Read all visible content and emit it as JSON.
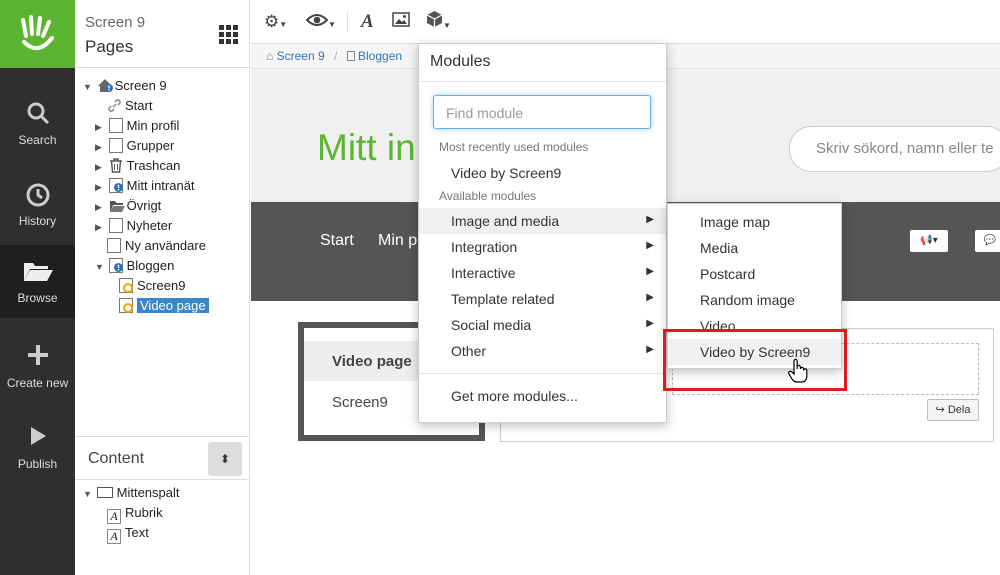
{
  "nav": {
    "items": [
      {
        "label": "Search",
        "icon": "search-icon"
      },
      {
        "label": "History",
        "icon": "history-icon"
      },
      {
        "label": "Browse",
        "icon": "folder-open-icon"
      },
      {
        "label": "Create new",
        "icon": "plus-icon"
      },
      {
        "label": "Publish",
        "icon": "play-icon"
      }
    ],
    "active": "Browse",
    "brand_color": "#5cb531"
  },
  "tree_panel": {
    "site": "Screen 9",
    "title": "Pages",
    "items": [
      {
        "label": "Screen 9"
      },
      {
        "label": "Start"
      },
      {
        "label": "Min profil"
      },
      {
        "label": "Grupper"
      },
      {
        "label": "Trashcan"
      },
      {
        "label": "Mitt intranät"
      },
      {
        "label": "Övrigt"
      },
      {
        "label": "Nyheter"
      },
      {
        "label": "Ny användare"
      },
      {
        "label": "Bloggen"
      },
      {
        "label": "Screen9"
      },
      {
        "label": "Video page"
      }
    ],
    "content_title": "Content",
    "content_items": [
      {
        "label": "Mittenspalt"
      },
      {
        "label": "Rubrik"
      },
      {
        "label": "Text"
      }
    ]
  },
  "breadcrumb": [
    "Screen 9",
    "Bloggen"
  ],
  "preview": {
    "brand": "Mitt in",
    "search_placeholder": "Skriv sökord, namn eller te",
    "menu": [
      "Start",
      "Min p"
    ],
    "subnav_title": "Video page",
    "subnav_item": "Screen9",
    "share_label": "Dela"
  },
  "modules": {
    "title": "Modules",
    "search_placeholder": "Find module",
    "recent_heading": "Most recently used modules",
    "recent": [
      "Video by Screen9"
    ],
    "available_heading": "Available modules",
    "categories": [
      "Image and media",
      "Integration",
      "Interactive",
      "Template related",
      "Social media",
      "Other"
    ],
    "more": "Get more modules..."
  },
  "submenu": {
    "items": [
      "Image map",
      "Media",
      "Postcard",
      "Random image",
      "Video",
      "Video by Screen9"
    ],
    "highlighted": "Video by Screen9",
    "highlight_color": "#e01b1b"
  }
}
